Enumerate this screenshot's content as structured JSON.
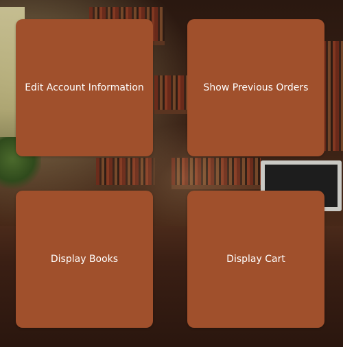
{
  "menu": {
    "edit_account_label": "Edit Account Information",
    "previous_orders_label": "Show Previous Orders",
    "display_books_label": "Display Books",
    "display_cart_label": "Display Cart"
  },
  "colors": {
    "tile_background": "#a0502c",
    "tile_text": "#ffffff"
  },
  "background": {
    "description_icon": "library-background-image"
  }
}
